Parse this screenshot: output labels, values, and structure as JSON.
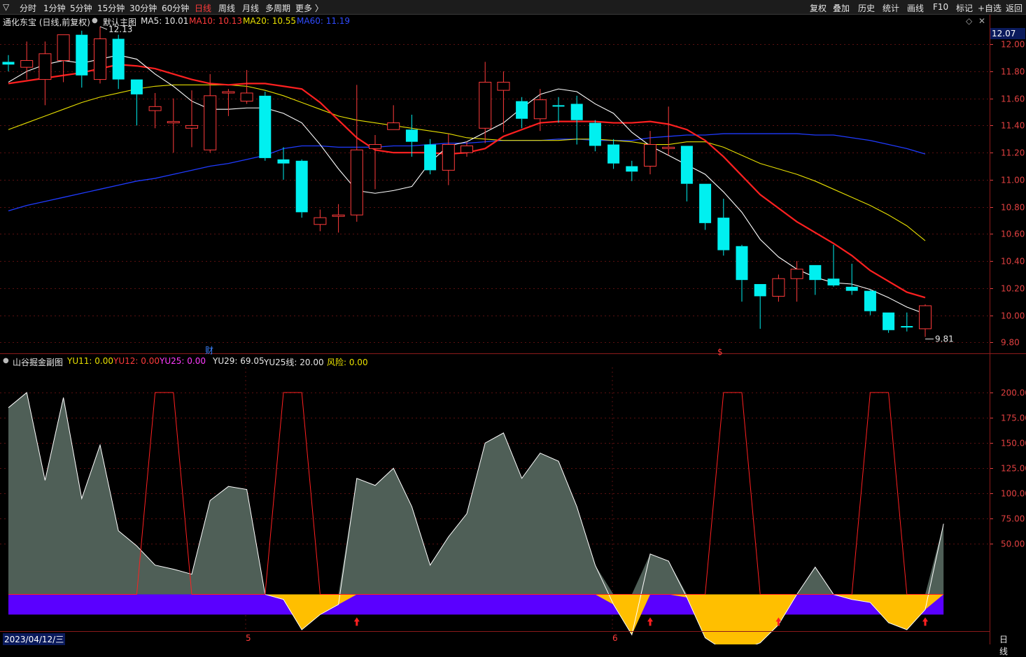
{
  "toolbar": {
    "periods": [
      "分时",
      "1分钟",
      "5分钟",
      "15分钟",
      "30分钟",
      "60分钟",
      "日线",
      "周线",
      "月线",
      "多周期",
      "更多 〉"
    ],
    "active_period": "日线",
    "actions": [
      "复权",
      "叠加",
      "历史",
      "统计",
      "画线",
      "F10",
      "标记",
      "+自选",
      "返回"
    ]
  },
  "main_info": {
    "title": "通化东宝 (日线,前复权)",
    "template": "默认主图",
    "ma5": "MA5: 10.01",
    "ma10": "MA10: 10.13",
    "ma20": "MA20: 10.55",
    "ma60": "MA60: 11.19"
  },
  "sub_info": {
    "title": "山谷掘金副图",
    "yu11": "YU11: 0.00",
    "yu12": "YU12: 0.00",
    "yu25": "YU25: 0.00",
    "yu29": "YU29: 69.05",
    "yu25line": "YU25线: 20.00",
    "risk": "风险: 0.00"
  },
  "colors": {
    "up": "#ff3b3b",
    "down": "#00f0f0",
    "ma5": "#ffffff",
    "ma10": "#ff2020",
    "ma20": "#e8e000",
    "ma60": "#1f3bff",
    "fill": "#4f5f57",
    "orange": "#ffbf00",
    "band": "#5a00ff"
  },
  "chart_data": [
    {
      "type": "candlestick",
      "price_axis": [
        9.8,
        10.0,
        10.2,
        10.4,
        10.6,
        10.8,
        11.0,
        11.2,
        11.4,
        11.6,
        11.8,
        12.0
      ],
      "price_axis_labels": [
        "9.80",
        "10.00",
        "10.20",
        "10.40",
        "10.60",
        "10.80",
        "11.00",
        "11.20",
        "11.40",
        "11.60",
        "11.80",
        "12.00"
      ],
      "current_price_label": "12.07",
      "ylim": [
        9.76,
        12.12
      ],
      "high_label": "12.13",
      "low_label": "9.81",
      "candles": [
        [
          11.87,
          11.85,
          11.92,
          11.8
        ],
        [
          11.83,
          11.88,
          12.02,
          11.74
        ],
        [
          11.74,
          11.93,
          12.02,
          11.55
        ],
        [
          11.88,
          12.07,
          12.07,
          11.72
        ],
        [
          12.07,
          11.77,
          12.1,
          11.68
        ],
        [
          11.74,
          12.04,
          12.13,
          11.71
        ],
        [
          12.04,
          11.74,
          12.07,
          11.67
        ],
        [
          11.74,
          11.63,
          11.74,
          11.4
        ],
        [
          11.51,
          11.54,
          11.64,
          11.38
        ],
        [
          11.43,
          11.43,
          11.6,
          11.2
        ],
        [
          11.38,
          11.4,
          11.66,
          11.24
        ],
        [
          11.22,
          11.62,
          11.78,
          11.2
        ],
        [
          11.65,
          11.65,
          11.67,
          11.47
        ],
        [
          11.58,
          11.64,
          11.81,
          11.56
        ],
        [
          11.62,
          11.16,
          11.65,
          11.14
        ],
        [
          11.15,
          11.12,
          11.24,
          11.0
        ],
        [
          11.14,
          10.76,
          11.15,
          10.72
        ],
        [
          10.67,
          10.72,
          10.78,
          10.62
        ],
        [
          10.74,
          10.74,
          10.82,
          10.61
        ],
        [
          10.74,
          11.22,
          11.7,
          10.69
        ],
        [
          11.23,
          11.26,
          11.33,
          10.93
        ],
        [
          11.37,
          11.42,
          11.55,
          11.37
        ],
        [
          11.37,
          11.28,
          11.48,
          11.17
        ],
        [
          11.26,
          11.07,
          11.3,
          11.04
        ],
        [
          11.07,
          11.26,
          11.34,
          10.96
        ],
        [
          11.2,
          11.25,
          11.28,
          11.17
        ],
        [
          11.38,
          11.72,
          11.87,
          11.27
        ],
        [
          11.66,
          11.72,
          11.8,
          11.35
        ],
        [
          11.58,
          11.45,
          11.61,
          11.38
        ],
        [
          11.45,
          11.59,
          11.67,
          11.36
        ],
        [
          11.55,
          11.54,
          11.61,
          11.42
        ],
        [
          11.56,
          11.44,
          11.62,
          11.26
        ],
        [
          11.42,
          11.25,
          11.44,
          11.21
        ],
        [
          11.26,
          11.12,
          11.3,
          11.08
        ],
        [
          11.1,
          11.06,
          11.14,
          10.99
        ],
        [
          11.1,
          11.26,
          11.36,
          11.04
        ],
        [
          11.24,
          11.24,
          11.54,
          11.18
        ],
        [
          11.25,
          10.97,
          11.25,
          10.84
        ],
        [
          10.97,
          10.68,
          10.97,
          10.63
        ],
        [
          10.72,
          10.48,
          10.86,
          10.44
        ],
        [
          10.51,
          10.26,
          10.52,
          10.1
        ],
        [
          10.23,
          10.14,
          10.23,
          9.9
        ],
        [
          10.14,
          10.27,
          10.3,
          10.1
        ],
        [
          10.27,
          10.34,
          10.4,
          10.1
        ],
        [
          10.37,
          10.26,
          10.37,
          10.15
        ],
        [
          10.27,
          10.22,
          10.52,
          10.21
        ],
        [
          10.21,
          10.18,
          10.38,
          10.15
        ],
        [
          10.18,
          10.03,
          10.19,
          10.0
        ],
        [
          10.02,
          9.89,
          10.02,
          9.87
        ],
        [
          9.92,
          9.91,
          10.02,
          9.88
        ],
        [
          9.9,
          10.07,
          10.08,
          9.84
        ]
      ],
      "ma5": [
        11.72,
        11.8,
        11.85,
        11.88,
        11.86,
        11.89,
        11.92,
        11.89,
        11.78,
        11.69,
        11.58,
        11.52,
        11.52,
        11.53,
        11.53,
        11.49,
        11.42,
        11.26,
        11.08,
        10.92,
        10.9,
        10.92,
        10.95,
        11.13,
        11.25,
        11.28,
        11.35,
        11.42,
        11.53,
        11.63,
        11.67,
        11.65,
        11.56,
        11.49,
        11.35,
        11.25,
        11.18,
        11.11,
        11.04,
        10.91,
        10.76,
        10.56,
        10.43,
        10.34,
        10.28,
        10.24,
        10.23,
        10.19,
        10.13,
        10.06,
        10.01
      ],
      "ma10": [
        11.71,
        11.73,
        11.75,
        11.77,
        11.79,
        11.82,
        11.85,
        11.84,
        11.82,
        11.78,
        11.74,
        11.71,
        11.7,
        11.71,
        11.71,
        11.69,
        11.67,
        11.57,
        11.44,
        11.31,
        11.22,
        11.2,
        11.2,
        11.2,
        11.19,
        11.2,
        11.23,
        11.32,
        11.37,
        11.42,
        11.43,
        11.43,
        11.43,
        11.42,
        11.42,
        11.43,
        11.41,
        11.37,
        11.29,
        11.17,
        11.03,
        10.89,
        10.79,
        10.69,
        10.61,
        10.53,
        10.44,
        10.33,
        10.25,
        10.17,
        10.13
      ],
      "ma20": [
        11.37,
        11.42,
        11.47,
        11.52,
        11.57,
        11.61,
        11.64,
        11.67,
        11.69,
        11.7,
        11.7,
        11.7,
        11.7,
        11.69,
        11.66,
        11.62,
        11.57,
        11.52,
        11.47,
        11.44,
        11.42,
        11.4,
        11.38,
        11.36,
        11.34,
        11.31,
        11.3,
        11.29,
        11.29,
        11.29,
        11.29,
        11.3,
        11.3,
        11.29,
        11.28,
        11.26,
        11.26,
        11.28,
        11.28,
        11.24,
        11.18,
        11.12,
        11.08,
        11.04,
        10.99,
        10.93,
        10.87,
        10.81,
        10.74,
        10.66,
        10.55
      ],
      "ma60": [
        10.77,
        10.81,
        10.84,
        10.87,
        10.9,
        10.93,
        10.96,
        10.99,
        11.01,
        11.04,
        11.07,
        11.1,
        11.12,
        11.15,
        11.18,
        11.23,
        11.25,
        11.25,
        11.24,
        11.24,
        11.24,
        11.25,
        11.25,
        11.26,
        11.27,
        11.27,
        11.28,
        11.29,
        11.29,
        11.29,
        11.3,
        11.3,
        11.29,
        11.29,
        11.29,
        11.31,
        11.32,
        11.33,
        11.33,
        11.34,
        11.34,
        11.34,
        11.34,
        11.34,
        11.33,
        11.33,
        11.31,
        11.29,
        11.26,
        11.23,
        11.19
      ]
    },
    {
      "type": "area",
      "axis": [
        50,
        75,
        100,
        125,
        150,
        175,
        200
      ],
      "axis_labels": [
        "50.00",
        "75.00",
        "100.00",
        "125.00",
        "150.00",
        "175.00",
        "200.00"
      ],
      "ylim": [
        -35,
        225
      ],
      "band_range": [
        -20,
        0
      ],
      "yu29": [
        185,
        200,
        113,
        195,
        95,
        148,
        63,
        48,
        29,
        25,
        20,
        93,
        107,
        104,
        0,
        -5,
        -35,
        -20,
        -10,
        115,
        108,
        125,
        87,
        29,
        57,
        80,
        150,
        160,
        115,
        140,
        132,
        87,
        29,
        -10,
        -40,
        40,
        33,
        -3,
        -43,
        -55,
        -55,
        -48,
        -30,
        0,
        27,
        0,
        -5,
        -8,
        -28,
        -35,
        -15,
        70
      ],
      "yu25line": [
        20,
        20,
        20,
        20,
        20,
        20,
        20,
        20,
        20,
        20,
        20,
        20,
        20,
        20,
        20,
        20,
        20,
        20,
        20,
        20,
        20,
        20,
        20,
        20,
        20,
        20,
        20,
        20,
        20,
        20,
        20,
        20,
        20,
        20,
        20,
        20,
        20,
        20,
        20,
        20,
        20,
        20,
        20,
        20,
        20,
        20,
        20,
        20,
        20,
        20,
        20,
        20
      ],
      "red_pulse": [
        0,
        0,
        0,
        0,
        0,
        0,
        0,
        0,
        200,
        200,
        0,
        0,
        0,
        0,
        0,
        200,
        200,
        0,
        0,
        0,
        0,
        0,
        0,
        0,
        0,
        0,
        0,
        0,
        0,
        0,
        0,
        0,
        0,
        0,
        0,
        0,
        0,
        0,
        0,
        200,
        200,
        0,
        0,
        0,
        0,
        0,
        0,
        200,
        200,
        0,
        0,
        0
      ],
      "arrow_bars": [
        19,
        35,
        42,
        50
      ]
    }
  ],
  "bottom": {
    "date": "2023/04/12/三",
    "month5": "5",
    "month6": "6",
    "period": "日线"
  },
  "markers": {
    "fin": "财",
    "dollar": "$"
  }
}
